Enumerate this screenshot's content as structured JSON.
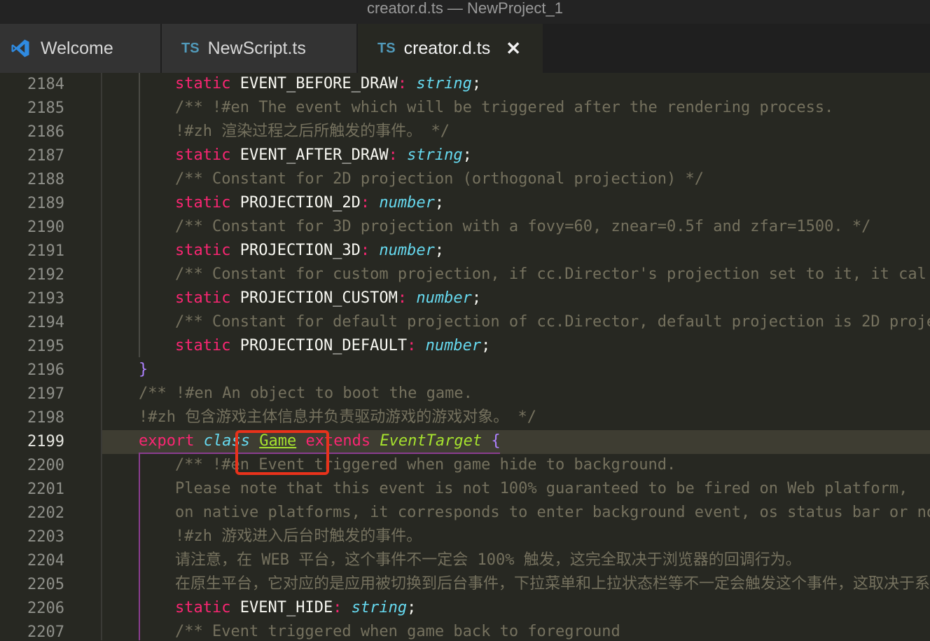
{
  "window": {
    "title": "creator.d.ts — NewProject_1"
  },
  "tabs": [
    {
      "label": "Welcome",
      "icon": "vscode-icon",
      "active": false
    },
    {
      "label": "NewScript.ts",
      "icon": "ts-icon",
      "badge": "TS",
      "active": false
    },
    {
      "label": "creator.d.ts",
      "icon": "ts-icon",
      "badge": "TS",
      "active": true,
      "close": "✕"
    }
  ],
  "editor": {
    "current_line": "2199",
    "line_numbers": [
      "2184",
      "2185",
      "2186",
      "2187",
      "2188",
      "2189",
      "2190",
      "2191",
      "2192",
      "2193",
      "2194",
      "2195",
      "2196",
      "2197",
      "2198",
      "2199",
      "2200",
      "2201",
      "2202",
      "2203",
      "2204",
      "2205",
      "2206",
      "2207"
    ],
    "lines": {
      "l2184": {
        "kw": "static",
        "name": "EVENT_BEFORE_DRAW",
        "colon": ":",
        "type": "string",
        "semi": ";"
      },
      "l2185": {
        "comment": "/** !#en The event which will be triggered after the rendering process."
      },
      "l2186": {
        "comment": "!#zh 渲染过程之后所触发的事件。 */"
      },
      "l2187": {
        "kw": "static",
        "name": "EVENT_AFTER_DRAW",
        "colon": ":",
        "type": "string",
        "semi": ";"
      },
      "l2188": {
        "comment": "/** Constant for 2D projection (orthogonal projection) */"
      },
      "l2189": {
        "kw": "static",
        "name": "PROJECTION_2D",
        "colon": ":",
        "type": "number",
        "semi": ";"
      },
      "l2190": {
        "comment": "/** Constant for 3D projection with a fovy=60, znear=0.5f and zfar=1500. */"
      },
      "l2191": {
        "kw": "static",
        "name": "PROJECTION_3D",
        "colon": ":",
        "type": "number",
        "semi": ";"
      },
      "l2192": {
        "comment": "/** Constant for custom projection, if cc.Director's projection set to it, it cal"
      },
      "l2193": {
        "kw": "static",
        "name": "PROJECTION_CUSTOM",
        "colon": ":",
        "type": "number",
        "semi": ";"
      },
      "l2194": {
        "comment": "/** Constant for default projection of cc.Director, default projection is 2D proje"
      },
      "l2195": {
        "kw": "static",
        "name": "PROJECTION_DEFAULT",
        "colon": ":",
        "type": "number",
        "semi": ";"
      },
      "l2196": {
        "brace": "}"
      },
      "l2197": {
        "comment": "/** !#en An object to boot the game."
      },
      "l2198": {
        "comment": "!#zh 包含游戏主体信息并负责驱动游戏的游戏对象。 */"
      },
      "l2199": {
        "export": "export",
        "cls": "class",
        "name": "Game",
        "ext": "extends",
        "parent": "EventTarget",
        "brace": "{"
      },
      "l2200": {
        "comment": "/** !#en Event triggered when game hide to background."
      },
      "l2201": {
        "comment": "Please note that this event is not 100% guaranteed to be fired on Web platform,"
      },
      "l2202": {
        "comment": "on native platforms, it corresponds to enter background event, os status bar or no"
      },
      "l2203": {
        "comment": "!#zh 游戏进入后台时触发的事件。"
      },
      "l2204": {
        "comment": "请注意，在 WEB 平台，这个事件不一定会 100% 触发，这完全取决于浏览器的回调行为。"
      },
      "l2205": {
        "comment": "在原生平台，它对应的是应用被切换到后台事件，下拉菜单和上拉状态栏等不一定会触发这个事件，这取决于系"
      },
      "l2206": {
        "kw": "static",
        "name": "EVENT_HIDE",
        "colon": ":",
        "type": "string",
        "semi": ";"
      },
      "l2207": {
        "comment": "/** Event triggered when game back to foreground"
      }
    }
  },
  "colors": {
    "background": "#272822",
    "keyword": "#f92672",
    "type": "#66d9ef",
    "comment": "#75715e",
    "class_name": "#a6e22e",
    "highlight_box": "#e8321b"
  }
}
